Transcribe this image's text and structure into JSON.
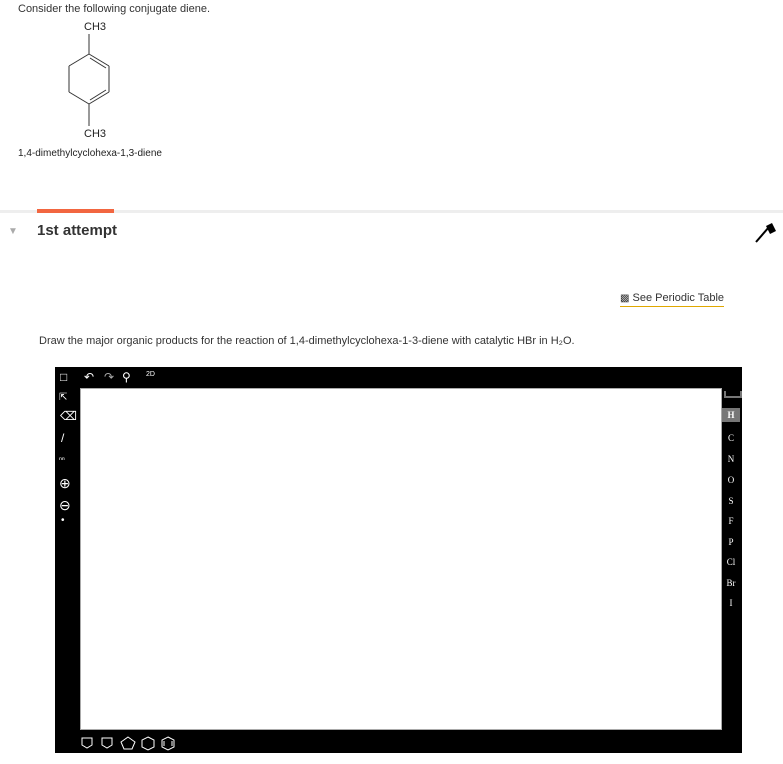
{
  "intro": "Consider the following conjugate diene.",
  "molecule": {
    "top_group": "CH3",
    "bottom_group": "CH3",
    "name": "1,4-dimethylcyclohexa-1,3-diene"
  },
  "attempt": {
    "label": "1st attempt",
    "tab_color": "#f26640"
  },
  "periodic_link": "See Periodic Table",
  "question": "Draw the major organic products for the reaction of 1,4-dimethylcyclohexa-1-3-diene with catalytic HBr in H₂O.",
  "editor": {
    "top_tools": [
      "new-document",
      "undo",
      "redo",
      "zoom",
      "2d-clean"
    ],
    "clean_label": "2D",
    "left_tools": [
      "select",
      "eraser",
      "bond",
      "chain",
      "positive-charge",
      "negative-charge",
      "radical"
    ],
    "elements": [
      "H",
      "C",
      "N",
      "O",
      "S",
      "F",
      "P",
      "Cl",
      "Br",
      "I"
    ],
    "selected_element": "H",
    "templates": [
      "cyclopropane",
      "cyclobutane",
      "cyclopentane",
      "cyclohexane",
      "benzene"
    ]
  }
}
